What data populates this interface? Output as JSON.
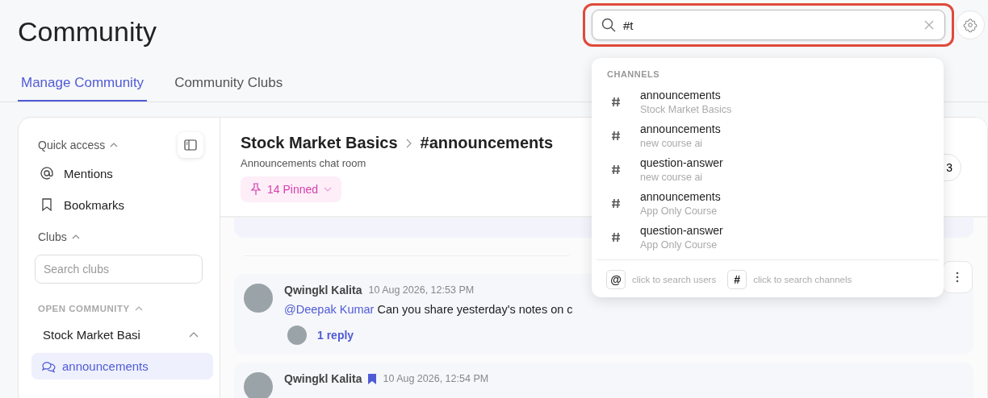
{
  "page_title": "Community",
  "search": {
    "value": "#t"
  },
  "tabs": [
    {
      "label": "Manage Community",
      "selected": true
    },
    {
      "label": "Community Clubs",
      "selected": false
    }
  ],
  "sidebar": {
    "quick_access": {
      "label": "Quick access",
      "expanded": true,
      "items": [
        {
          "label": "Mentions",
          "kind": "mention"
        },
        {
          "label": "Bookmarks",
          "kind": "bookmark"
        }
      ]
    },
    "clubs": {
      "label": "Clubs",
      "expanded": true,
      "search_placeholder": "Search clubs",
      "groups": [
        {
          "label": "OPEN COMMUNITY",
          "expanded": true,
          "clubs": [
            {
              "name": "Stock Market Basi",
              "expanded": true,
              "channels": [
                {
                  "name": "announcements",
                  "selected": true
                }
              ]
            }
          ]
        }
      ]
    }
  },
  "channel_header": {
    "club": "Stock Market Basics",
    "channel": "#announcements",
    "description": "Announcements chat room",
    "pinned": "14 Pinned",
    "member_count": "3"
  },
  "messages": [
    {
      "author": "Qwingkl Kalita",
      "bookmarked": false,
      "time": "10 Aug 2026, 12:53 PM",
      "mention": "@Deepak Kumar",
      "text": "Can you share yesterday's notes on c",
      "reply_count": "1 reply"
    },
    {
      "author": "Qwingkl Kalita",
      "bookmarked": true,
      "time": "10 Aug 2026, 12:54 PM"
    }
  ],
  "dropdown": {
    "section": "CHANNELS",
    "results": [
      {
        "name": "announcements",
        "club": "Stock Market Basics"
      },
      {
        "name": "announcements",
        "club": "new course ai"
      },
      {
        "name": "question-answer",
        "club": "new course ai"
      },
      {
        "name": "announcements",
        "club": "App Only Course"
      },
      {
        "name": "question-answer",
        "club": "App Only Course"
      }
    ],
    "hints": [
      {
        "key": "@",
        "label": "click to search users"
      },
      {
        "key": "#",
        "label": "click to search channels"
      }
    ]
  }
}
